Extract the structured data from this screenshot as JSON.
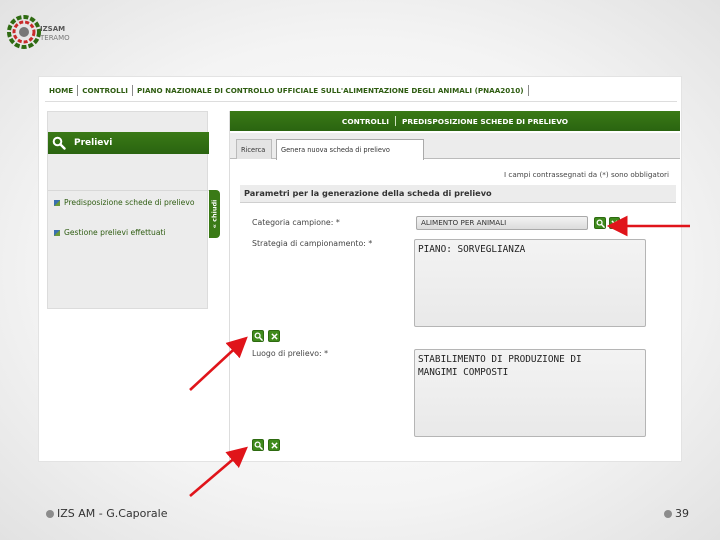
{
  "logo": {
    "line1": "IZSAM",
    "line2": "TERAMO",
    "small": "G.Caporale"
  },
  "breadcrumb": {
    "items": [
      "HOME",
      "CONTROLLI",
      "PIANO NAZIONALE DI CONTROLLO UFFICIALE SULL'ALIMENTAZIONE DEGLI ANIMALI (PNAA2010)"
    ]
  },
  "sidebar": {
    "title": "Prelievi",
    "items": [
      {
        "label": "Predisposizione schede di prelievo"
      },
      {
        "label": "Gestione prelievi effettuati"
      }
    ],
    "collapse_label": "« chiudi"
  },
  "main": {
    "header_part1": "CONTROLLI",
    "header_part2": "PREDISPOSIZIONE SCHEDE DI PRELIEVO",
    "tabs": [
      {
        "label": "Ricerca"
      },
      {
        "label": "Genera nuova scheda di prelievo"
      }
    ],
    "required_note": "I campi contrassegnati da (*) sono obbligatori",
    "section_title": "Parametri per la generazione della scheda di prelievo",
    "fields": {
      "categoria_label": "Categoria campione: *",
      "categoria_value": "ALIMENTO PER ANIMALI",
      "strategia_label": "Strategia di campionamento: *",
      "strategia_value": "PIANO: SORVEGLIANZA",
      "luogo_label": "Luogo di prelievo: *",
      "luogo_value": "STABILIMENTO DI PRODUZIONE DI\nMANGIMI COMPOSTI"
    }
  },
  "footer": {
    "left": "IZS AM  -  G.Caporale",
    "right": "39"
  },
  "colors": {
    "accent_green": "#2f6b12",
    "arrow_red": "#e0141a"
  },
  "icons": [
    "search-icon",
    "close-icon",
    "bullet-icon"
  ]
}
